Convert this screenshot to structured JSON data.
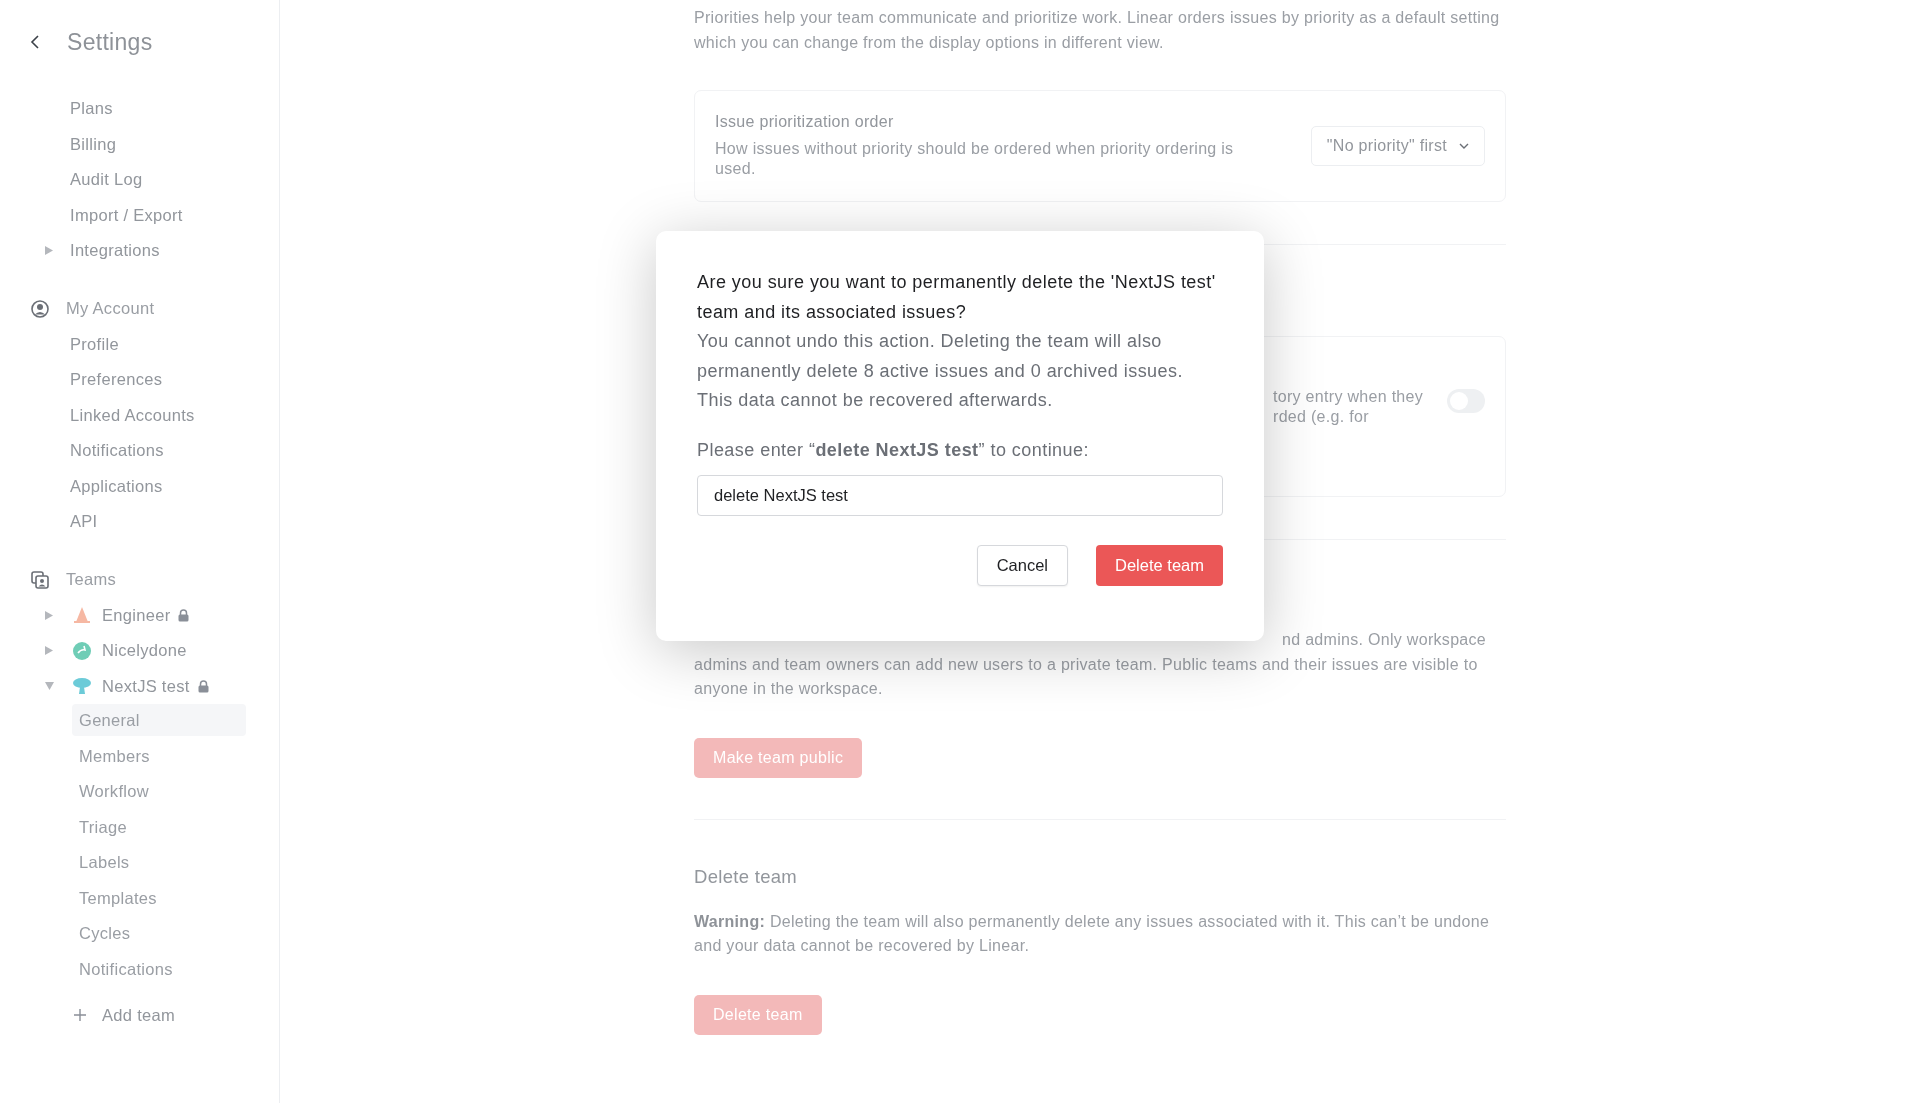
{
  "sidebar": {
    "title": "Settings",
    "general_items": [
      {
        "label": "Plans"
      },
      {
        "label": "Billing"
      },
      {
        "label": "Audit Log"
      },
      {
        "label": "Import / Export"
      },
      {
        "label": "Integrations",
        "expanded": false
      }
    ],
    "account": {
      "heading": "My Account",
      "items": [
        {
          "label": "Profile"
        },
        {
          "label": "Preferences"
        },
        {
          "label": "Linked Accounts"
        },
        {
          "label": "Notifications"
        },
        {
          "label": "Applications"
        },
        {
          "label": "API"
        }
      ]
    },
    "teams": {
      "heading": "Teams",
      "items": [
        {
          "name": "Engineer",
          "color": "#f6b8a3",
          "locked": true,
          "expanded": false
        },
        {
          "name": "Nicelydone",
          "color": "#6fcdb6",
          "locked": false,
          "expanded": false
        },
        {
          "name": "NextJS test",
          "color": "#6ccbd8",
          "locked": true,
          "expanded": true,
          "children": [
            {
              "label": "General",
              "selected": true
            },
            {
              "label": "Members",
              "selected": false
            },
            {
              "label": "Workflow",
              "selected": false
            },
            {
              "label": "Triage",
              "selected": false
            },
            {
              "label": "Labels",
              "selected": false
            },
            {
              "label": "Templates",
              "selected": false
            },
            {
              "label": "Cycles",
              "selected": false
            },
            {
              "label": "Notifications",
              "selected": false
            }
          ]
        }
      ],
      "add_label": "Add team"
    }
  },
  "content": {
    "intro": "Priorities help your team communicate and prioritize work. Linear orders issues by priority as a default setting which you can change from the display options in different view.",
    "priority_card": {
      "title": "Issue prioritization order",
      "description": "How issues without priority should be ordered when priority ordering is used.",
      "dropdown": "\"No priority\" first"
    },
    "history_card": {
      "lines": [
        "tory entry when they",
        "rded (e.g. for"
      ],
      "toggle_on": false
    },
    "privacy": {
      "first_line_fragment": "nd admins. Only workspace",
      "rest": "admins and team owners can add new users to a private team. Public teams and their issues are visible to anyone in the workspace.",
      "button": "Make team public"
    },
    "delete_section": {
      "heading": "Delete team",
      "warning": "**Warning:** Deleting the team will also permanently delete any issues associated with it. This can’t be undone and your data cannot be recovered by Linear.",
      "button": "Delete team"
    }
  },
  "modal": {
    "title": "Are you sure you want to permanently delete the 'NextJS test' team and its associated issues?",
    "body": "You cannot undo this action. Deleting the team will also permanently delete 8 active issues and 0 archived issues. This data cannot be recovered afterwards.",
    "prompt": "Please enter “**delete NextJS test**” to continue:",
    "input_value": "delete NextJS test",
    "buttons": [
      {
        "label": "Cancel",
        "kind": "secondary"
      },
      {
        "label": "Delete team",
        "kind": "danger"
      }
    ]
  }
}
